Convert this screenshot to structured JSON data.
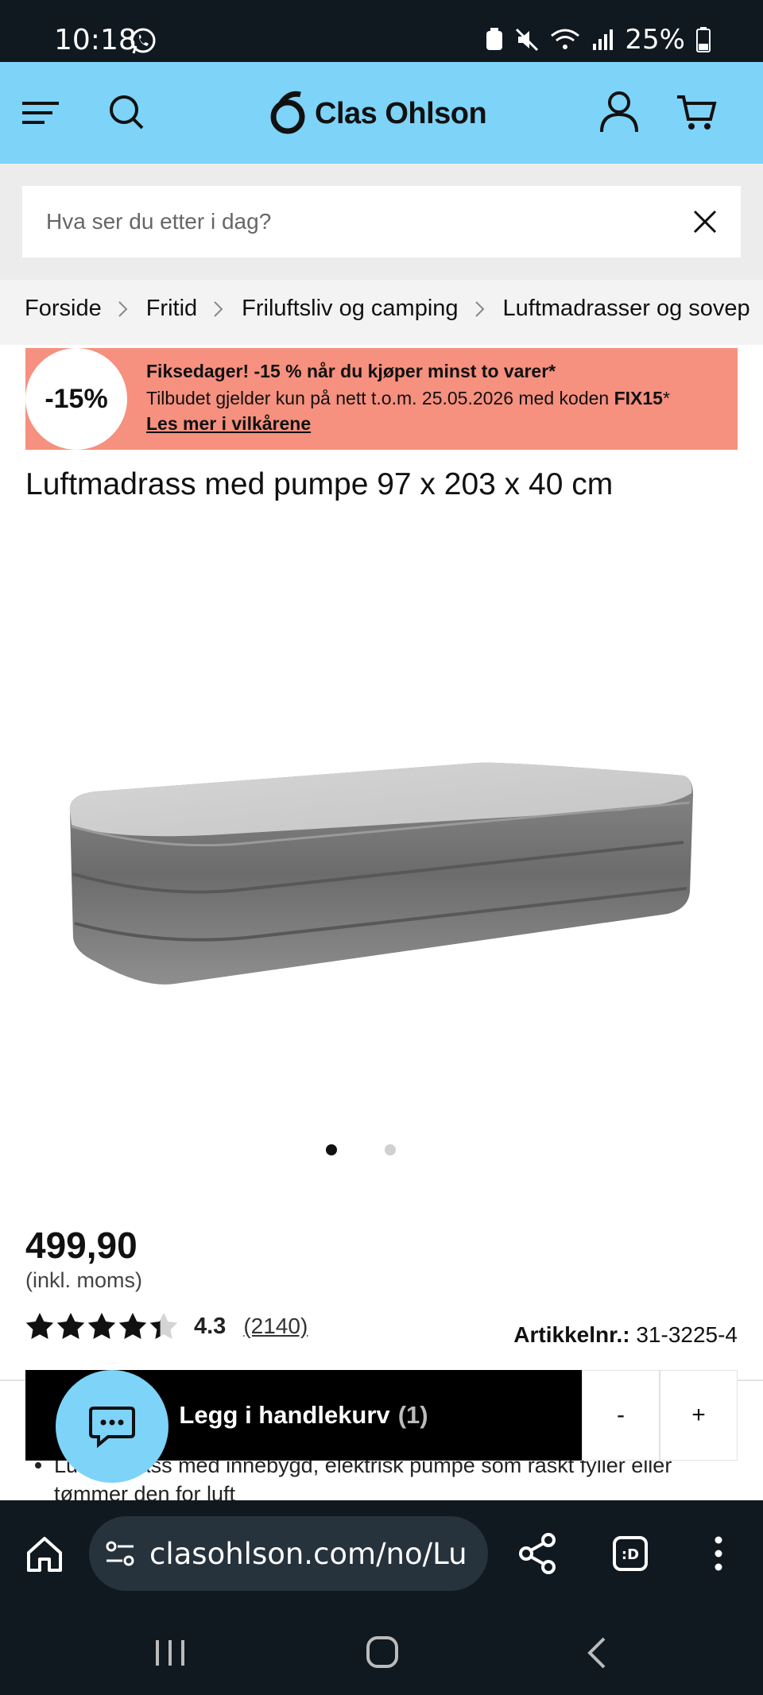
{
  "status_bar": {
    "time": "10:18",
    "battery": "25%"
  },
  "header": {
    "brand": "Clas Ohlson",
    "accent_color": "#7dd3f8"
  },
  "search": {
    "placeholder": "Hva ser du etter i dag?"
  },
  "breadcrumb": [
    "Forside",
    "Fritid",
    "Friluftsliv og camping",
    "Luftmadrasser og sovep"
  ],
  "promo": {
    "badge": "-15%",
    "headline": "Fiksedager! -15 % når du kjøper minst to varer*",
    "detail_prefix": "Tilbudet gjelder kun på nett t.o.m. 25.05.2026 med koden",
    "code": "FIX15",
    "code_suffix": "*",
    "link": "Les mer i vilkårene",
    "color": "#f6907f"
  },
  "product": {
    "title": "Luftmadrass med pumpe 97 x 203 x 40 cm",
    "image_count": 2,
    "active_image": 1,
    "price": "499,90",
    "vat_note": "(inkl. moms)",
    "rating": "4.3",
    "rating_value": 4.3,
    "review_count": "(2140)",
    "article_label": "Artikkelnr.:",
    "article_number": "31-3225-4",
    "description_partial": "Luftmadrass med innebygd, elektrisk pumpe som raskt fyller eller tømmer den for luft"
  },
  "cart_bar": {
    "add_label": "Legg i handlekurv",
    "quantity": "(1)",
    "minus": "-",
    "plus": "+"
  },
  "browser": {
    "url": "clasohlson.com/no/Lu"
  }
}
